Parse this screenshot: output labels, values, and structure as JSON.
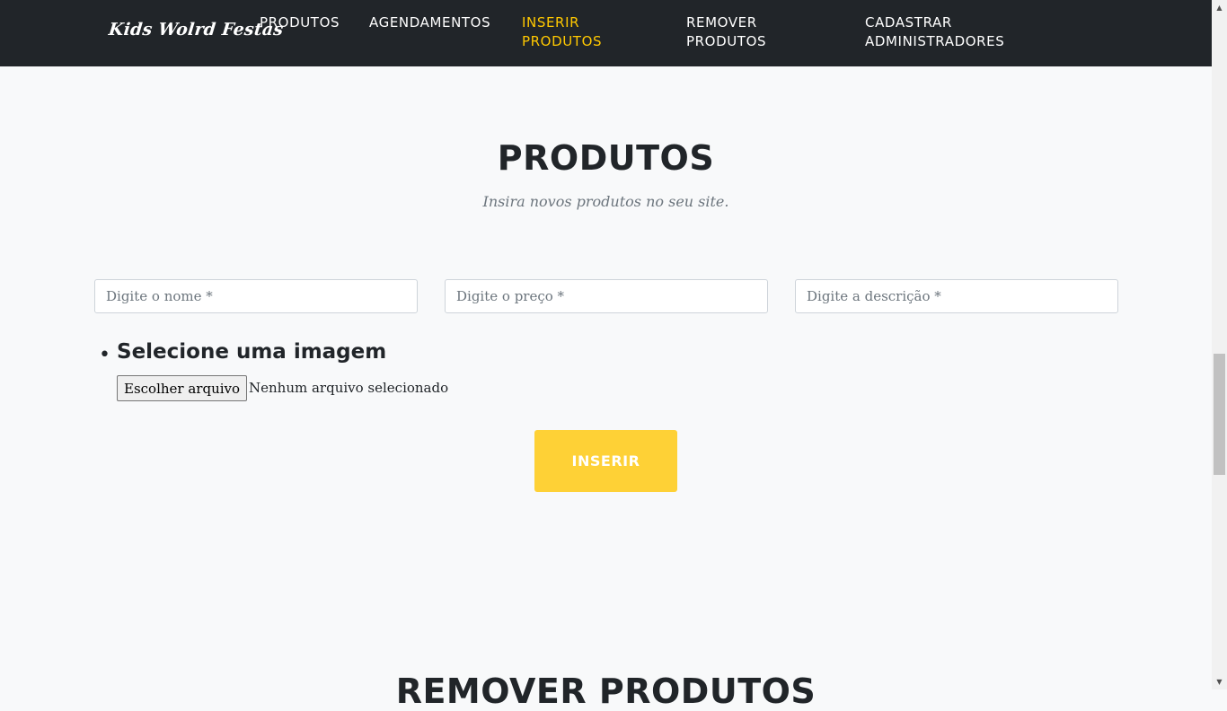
{
  "navbar": {
    "brand": "Kids Wolrd Festas",
    "items": [
      {
        "label": "PRODUTOS"
      },
      {
        "label": "AGENDAMENTOS"
      },
      {
        "label": "INSERIR\nPRODUTOS"
      },
      {
        "label": "REMOVER\nPRODUTOS"
      },
      {
        "label": "CADASTRAR\nADMINISTRADORES"
      }
    ],
    "active_item": "INSERIR PRODUTOS",
    "accent_color": "#ffc800"
  },
  "section": {
    "title": "PRODUTOS",
    "subtitle": "Insira novos produtos no seu site."
  },
  "form": {
    "name_placeholder": "Digite o nome *",
    "price_placeholder": "Digite o preço *",
    "description_placeholder": "Digite a descrição *",
    "image_label": "Selecione uma imagem",
    "file_button_label": "Escolher arquivo",
    "file_status": "Nenhum arquivo selecionado",
    "submit_label": "INSERIR",
    "submit_color": "#fed136"
  },
  "next_section": {
    "title": "REMOVER PRODUTOS"
  },
  "icons": {
    "scroll_up": "scroll-up-arrow-icon",
    "scroll_down": "scroll-down-arrow-icon"
  }
}
